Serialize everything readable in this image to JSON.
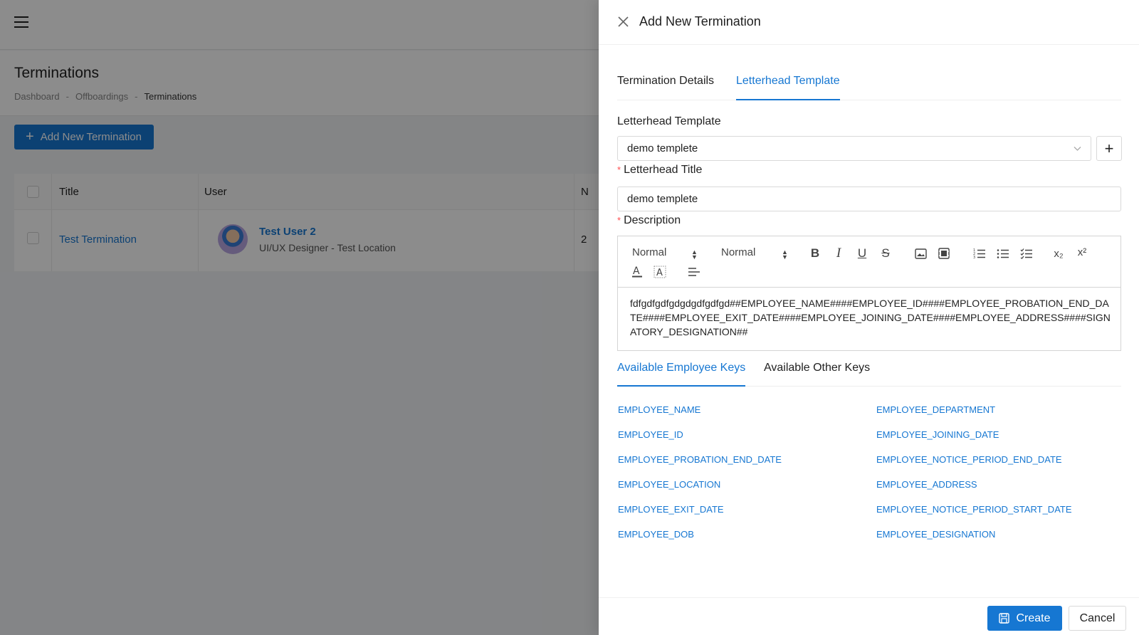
{
  "page": {
    "title": "Terminations",
    "breadcrumb": [
      "Dashboard",
      "Offboardings",
      "Terminations"
    ],
    "separator": "-",
    "add_button": "Add New Termination"
  },
  "table": {
    "columns": [
      "Title",
      "User",
      "N"
    ],
    "rows": [
      {
        "title": "Test Termination",
        "user_name": "Test User 2",
        "user_sub": "UI/UX Designer - Test Location",
        "extra": "2"
      }
    ]
  },
  "drawer": {
    "title": "Add New Termination",
    "tabs": [
      "Termination Details",
      "Letterhead Template"
    ],
    "active_tab": "Letterhead Template",
    "letterhead_template_label": "Letterhead Template",
    "letterhead_template_value": "demo templete",
    "letterhead_title_label": "Letterhead Title",
    "letterhead_title_value": "demo templete",
    "description_label": "Description",
    "toolbar": {
      "heading_select": "Normal",
      "size_select": "Normal",
      "subscript": "x₂",
      "superscript": "x²"
    },
    "description_text": "fdfgdfgdfgdgdgdfgdfgd##EMPLOYEE_NAME####EMPLOYEE_ID####EMPLOYEE_PROBATION_END_DATE####EMPLOYEE_EXIT_DATE####EMPLOYEE_JOINING_DATE####EMPLOYEE_ADDRESS####SIGNATORY_DESIGNATION##",
    "key_tabs": [
      "Available Employee Keys",
      "Available Other Keys"
    ],
    "keys_left": [
      "EMPLOYEE_NAME",
      "EMPLOYEE_ID",
      "EMPLOYEE_PROBATION_END_DATE",
      "EMPLOYEE_LOCATION",
      "EMPLOYEE_EXIT_DATE",
      "EMPLOYEE_DOB"
    ],
    "keys_right": [
      "EMPLOYEE_DEPARTMENT",
      "EMPLOYEE_JOINING_DATE",
      "EMPLOYEE_NOTICE_PERIOD_END_DATE",
      "EMPLOYEE_ADDRESS",
      "EMPLOYEE_NOTICE_PERIOD_START_DATE",
      "EMPLOYEE_DESIGNATION"
    ],
    "create_button": "Create",
    "cancel_button": "Cancel"
  },
  "colors": {
    "primary": "#1677d2",
    "required": "#ff4d4f",
    "overlay": "rgba(0,0,0,0.45)"
  }
}
